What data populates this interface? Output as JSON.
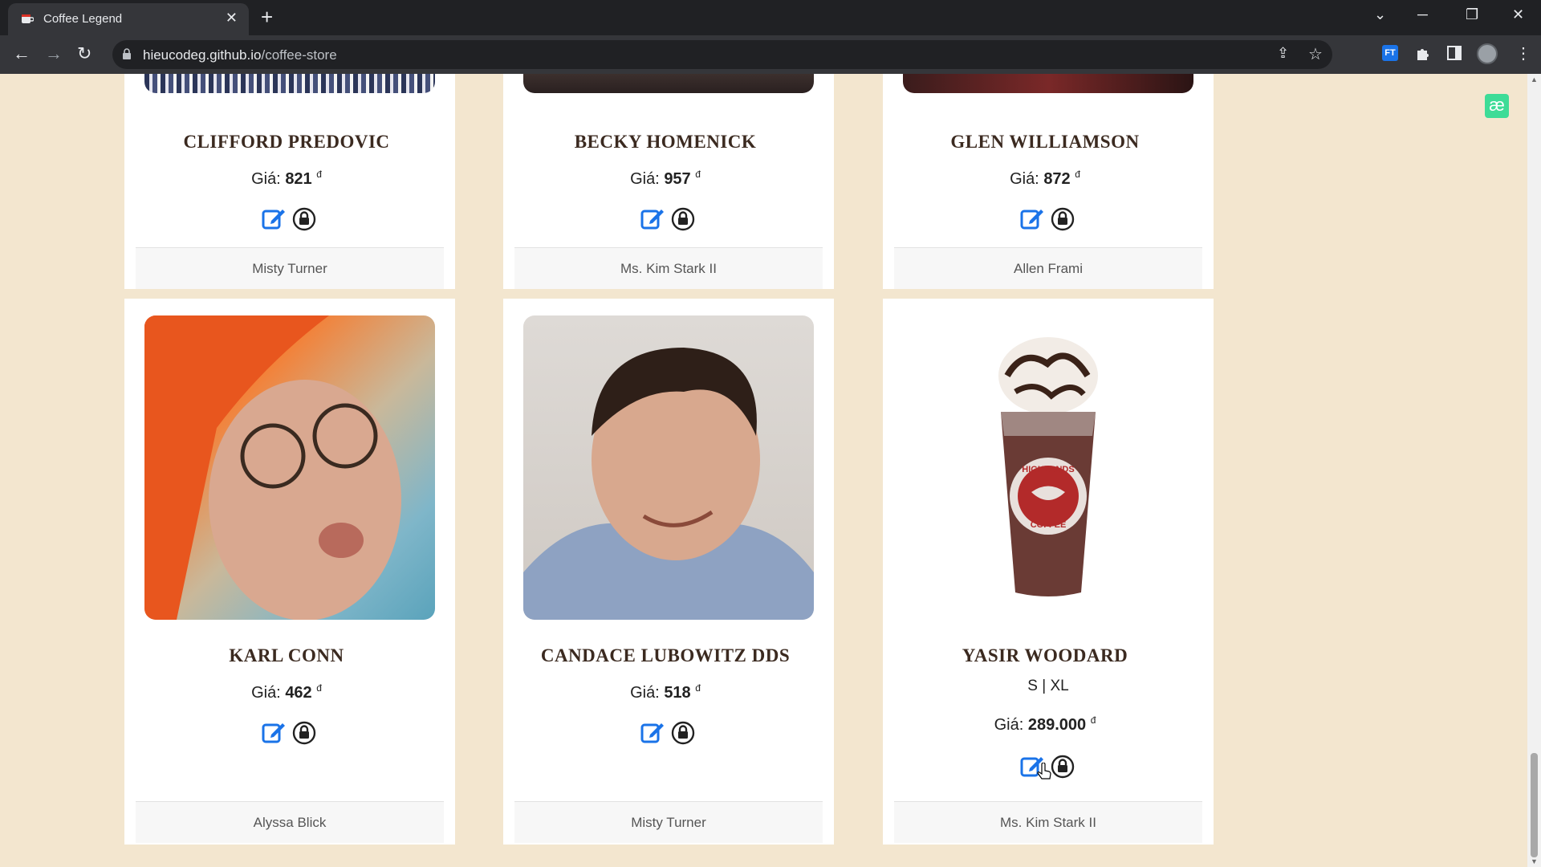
{
  "browser": {
    "tab_title": "Coffee Legend",
    "url_host": "hieucodeg.github.io",
    "url_path": "/coffee-store",
    "extension_label": "FT"
  },
  "page": {
    "badge": "æ",
    "price_prefix": "Giá:",
    "currency": "đ"
  },
  "products": [
    {
      "name": "CLIFFORD PREDOVIC",
      "price": "821",
      "seller": "Misty Turner"
    },
    {
      "name": "BECKY HOMENICK",
      "price": "957",
      "seller": "Ms. Kim Stark II"
    },
    {
      "name": "GLEN WILLIAMSON",
      "price": "872",
      "seller": "Allen Frami"
    },
    {
      "name": "KARL CONN",
      "price": "462",
      "seller": "Alyssa Blick"
    },
    {
      "name": "CANDACE LUBOWITZ DDS",
      "price": "518",
      "seller": "Misty Turner"
    },
    {
      "name": "YASIR WOODARD",
      "sizes": "S | XL",
      "price": "289.000",
      "seller": "Ms. Kim Stark II",
      "cup_logo_text": "HIGHLANDS COFFEE"
    }
  ],
  "colors": {
    "page_bg": "#f3e6cf",
    "card_bg": "#ffffff",
    "edit_icon": "#1a73e8",
    "name_text": "#3b2a20"
  }
}
